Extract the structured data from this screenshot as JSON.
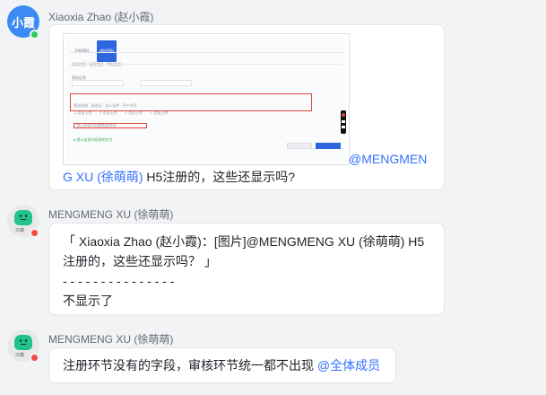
{
  "colors": {
    "background": "#f2f3f5",
    "bubble": "#ffffff",
    "mention": "#3370ff",
    "avatar_blue": "#3c8bf4",
    "online": "#34c759",
    "busy": "#f54a45"
  },
  "messages": [
    {
      "sender": "Xiaoxia Zhao (赵小霞)",
      "avatar_text": "小霞",
      "status": "online",
      "image": {
        "alt": "screenshot",
        "icon": "image-thumbnail"
      },
      "mention_part1": "@MENGMEN",
      "mention_part2": "G XU (徐萌萌)",
      "text": " H5注册的，这些还显示吗?"
    },
    {
      "sender": "MENGMENG XU (徐萌萌)",
      "avatar_tag": "只做",
      "status": "busy",
      "quote_line1": "「 Xiaoxia Zhao (赵小霞)：[图片]@MENGMENG XU (徐萌萌) H5",
      "quote_line2": "注册的，这些还显示吗？ 」",
      "divider": "- - - - - - - - - - - - - - -",
      "reply": "不显示了"
    },
    {
      "sender": "MENGMENG XU (徐萌萌)",
      "avatar_tag": "只做",
      "status": "busy",
      "text": "注册环节没有的字段，审核环节统一都不出现 ",
      "mention": "@全体成员"
    }
  ]
}
